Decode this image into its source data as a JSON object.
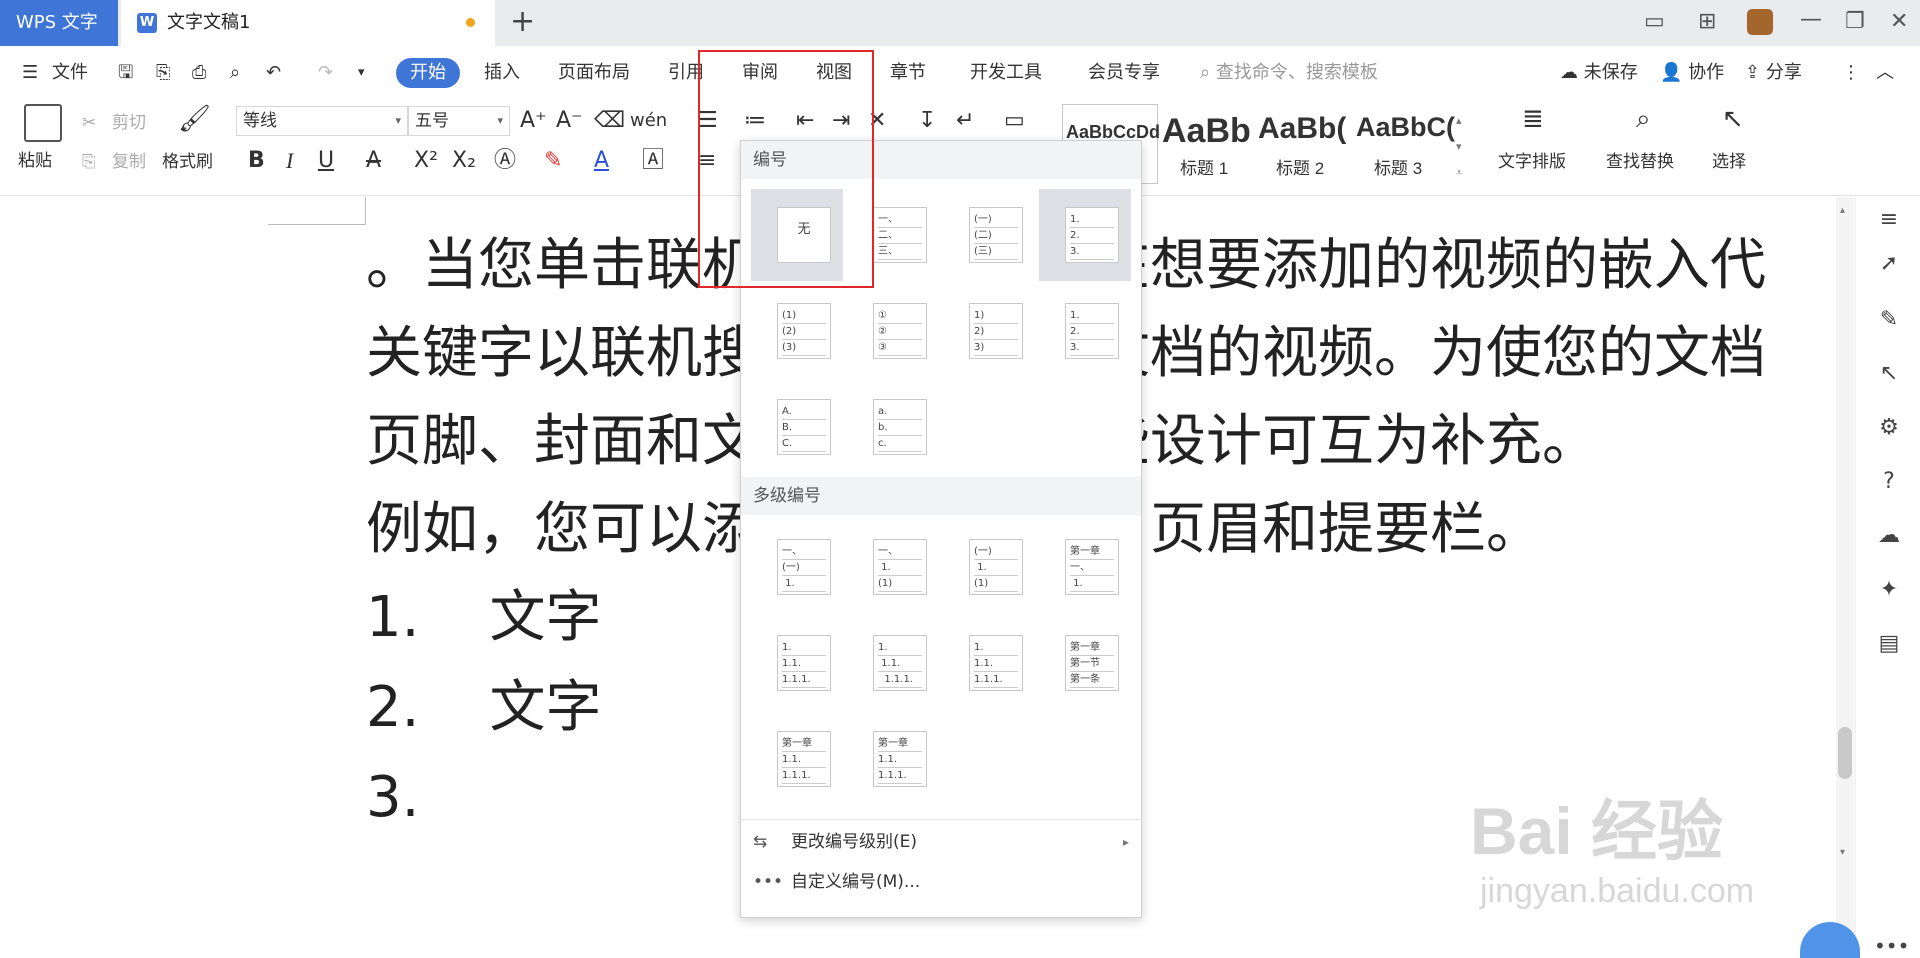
{
  "titlebar": {
    "app_tab": "WPS 文字",
    "doc_tab": "文字文稿1",
    "doc_icon": "W",
    "new_tab_icon": "plus-icon"
  },
  "menubar": {
    "file": "文件",
    "tabs": [
      "开始",
      "插入",
      "页面布局",
      "引用",
      "审阅",
      "视图",
      "章节",
      "开发工具",
      "会员专享"
    ],
    "search_placeholder": "查找命令、搜索模板",
    "unsaved": "未保存",
    "collab": "协作",
    "share": "分享"
  },
  "ribbon": {
    "paste": "粘贴",
    "cut": "剪切",
    "copy": "复制",
    "format_painter": "格式刷",
    "font_name": "等线",
    "font_size": "五号",
    "styles": [
      {
        "preview": "AaBbCcDd",
        "label": ""
      },
      {
        "preview": "AaBb",
        "label": "标题 1"
      },
      {
        "preview": "AaBb(",
        "label": "标题 2"
      },
      {
        "preview": "AaBbC(",
        "label": "标题 3"
      }
    ],
    "text_layout": "文字排版",
    "find_replace": "查找替换",
    "select": "选择"
  },
  "document": {
    "lines": [
      "。当您单击联机视频时，可以在想要添加的视频的嵌入代",
      "关键字以联机搜索最适合您的文档的视频。为使您的文档",
      "页脚、封面和文本框设计，这些设计可互为补充。",
      "例如，您可以添加匹配的封面、页眉和提要栏。"
    ],
    "list": [
      {
        "num": "1.",
        "text": "文字"
      },
      {
        "num": "2.",
        "text": "文字"
      },
      {
        "num": "3.",
        "text": ""
      }
    ]
  },
  "dropdown": {
    "numbering_title": "编号",
    "none_label": "无",
    "multilevel_title": "多级编号",
    "change_level": "更改编号级别(E)",
    "custom": "自定义编号(M)..."
  },
  "watermark": {
    "logo": "Bai 经验",
    "url": "jingyan.baidu.com"
  },
  "colors": {
    "accent": "#3f75d6",
    "highlight_box": "#e0282a"
  }
}
